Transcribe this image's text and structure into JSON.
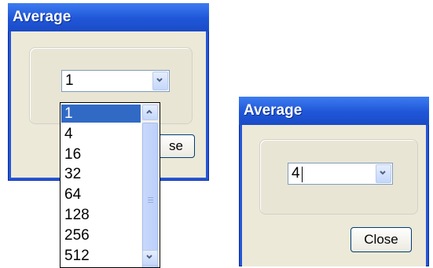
{
  "left_dialog": {
    "title": "Average",
    "combo_value": "1",
    "close_label": "Close",
    "close_visible_text": "se",
    "dropdown_items": [
      "1",
      "4",
      "16",
      "32",
      "64",
      "128",
      "256",
      "512"
    ],
    "selected_item": "1"
  },
  "right_dialog": {
    "title": "Average",
    "combo_value": "4",
    "close_label": "Close"
  },
  "icons": {
    "combo_arrow": "chevron-down-icon",
    "scroll_up": "chevron-up-icon",
    "scroll_down": "chevron-down-icon"
  },
  "colors": {
    "title_blue": "#2457d6",
    "selection_blue": "#316ac5",
    "dialog_face": "#ece9d8"
  }
}
